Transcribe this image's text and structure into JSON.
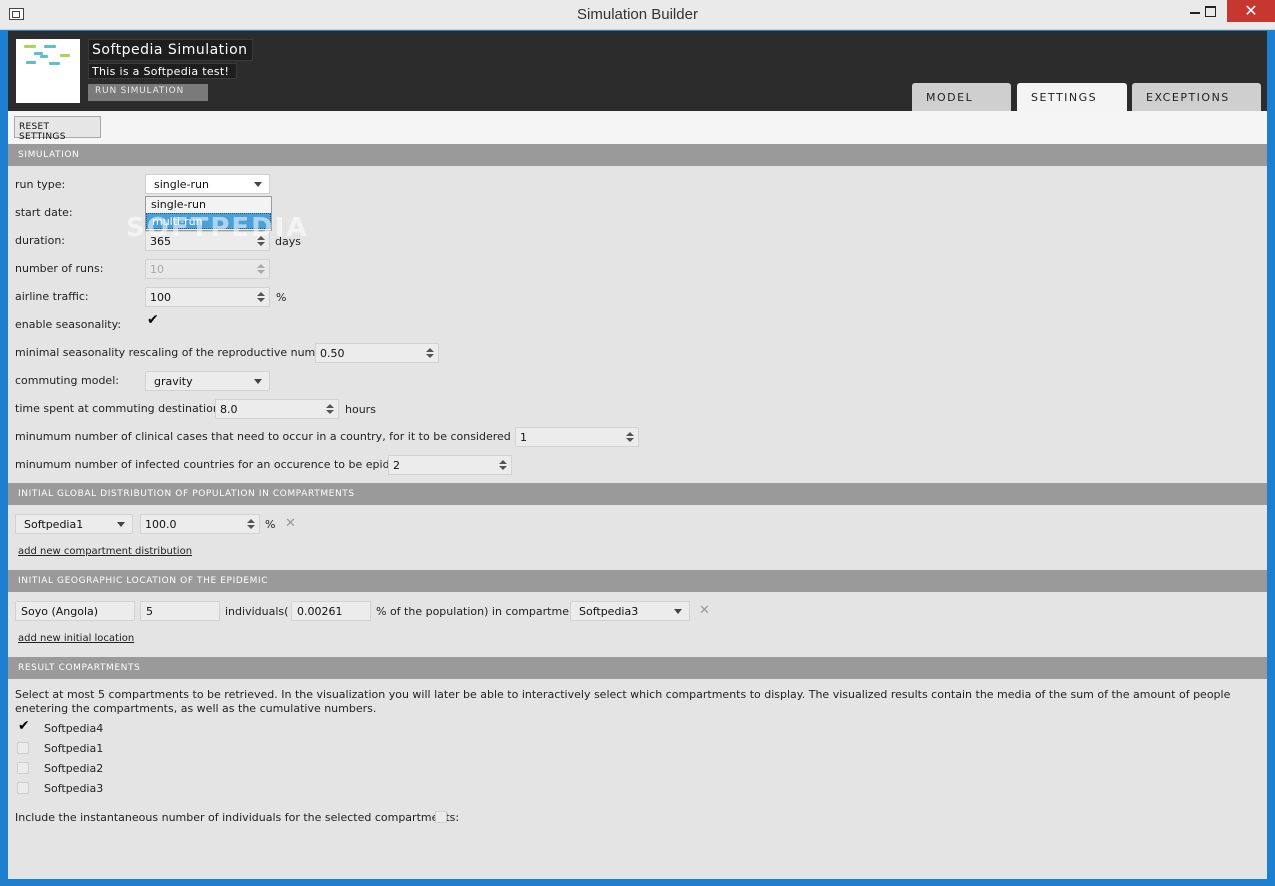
{
  "window": {
    "title": "Simulation Builder",
    "close_glyph": "✕"
  },
  "header": {
    "sim_name": "Softpedia Simulation",
    "sim_desc": "This is a Softpedia test!",
    "run_label": "RUN SIMULATION",
    "tabs": [
      "MODEL",
      "SETTINGS",
      "EXCEPTIONS"
    ]
  },
  "toolbar": {
    "reset_label": "RESET SETTINGS"
  },
  "sections": {
    "simulation": "SIMULATION",
    "population": "INITIAL GLOBAL DISTRIBUTION OF POPULATION IN COMPARTMENTS",
    "location": "INITIAL GEOGRAPHIC LOCATION OF THE EPIDEMIC",
    "results": "RESULT COMPARTMENTS"
  },
  "simulation": {
    "run_type_label": "run type:",
    "run_type_value": "single-run",
    "run_type_options": [
      "single-run",
      "multi-run"
    ],
    "start_date_label": "start date:",
    "duration_label": "duration:",
    "duration_value": "365",
    "duration_unit": "days",
    "num_runs_label": "number of runs:",
    "num_runs_value": "10",
    "airline_label": "airline traffic:",
    "airline_value": "100",
    "airline_unit": "%",
    "seasonality_label": "enable seasonality:",
    "min_season_label": "minimal seasonality rescaling of the reproductive number:",
    "min_season_value": "0.50",
    "commuting_label": "commuting model:",
    "commuting_value": "gravity",
    "time_spent_label": "time spent at commuting destination:",
    "time_spent_value": "8.0",
    "time_spent_unit": "hours",
    "min_cases_label": "minumum number of clinical cases that need to occur in a country, for it to be considered infected:",
    "min_cases_value": "1",
    "min_countries_label": "minumum number of infected countries for an occurence to be epidemic:",
    "min_countries_value": "2"
  },
  "population": {
    "compartment": "Softpedia1",
    "percent": "100.0",
    "unit": "%",
    "add_link": "add new compartment distribution"
  },
  "location": {
    "place": "Soyo (Angola)",
    "count": "5",
    "individuals_label": "individuals(",
    "fraction": "0.00261",
    "suffix_label": "% of the population) in compartment",
    "compartment": "Softpedia3",
    "add_link": "add new initial location"
  },
  "results": {
    "description": "Select at most 5 compartments to be retrieved. In the visualization you will later be able to interactively select which compartments to display. The visualized results contain the media of the sum of the amount of people enetering the compartments, as well as the cumulative numbers.",
    "items": [
      {
        "label": "Softpedia4",
        "checked": true
      },
      {
        "label": "Softpedia1",
        "checked": false
      },
      {
        "label": "Softpedia2",
        "checked": false
      },
      {
        "label": "Softpedia3",
        "checked": false
      }
    ],
    "instantaneous_label": "Include the instantaneous number of individuals for the selected compartments:"
  },
  "watermark": "SOFTPEDIA",
  "colors": {
    "accent": "#4aa0da",
    "section": "#9a9a9a",
    "header": "#2c2c2c",
    "close": "#c7372f"
  }
}
